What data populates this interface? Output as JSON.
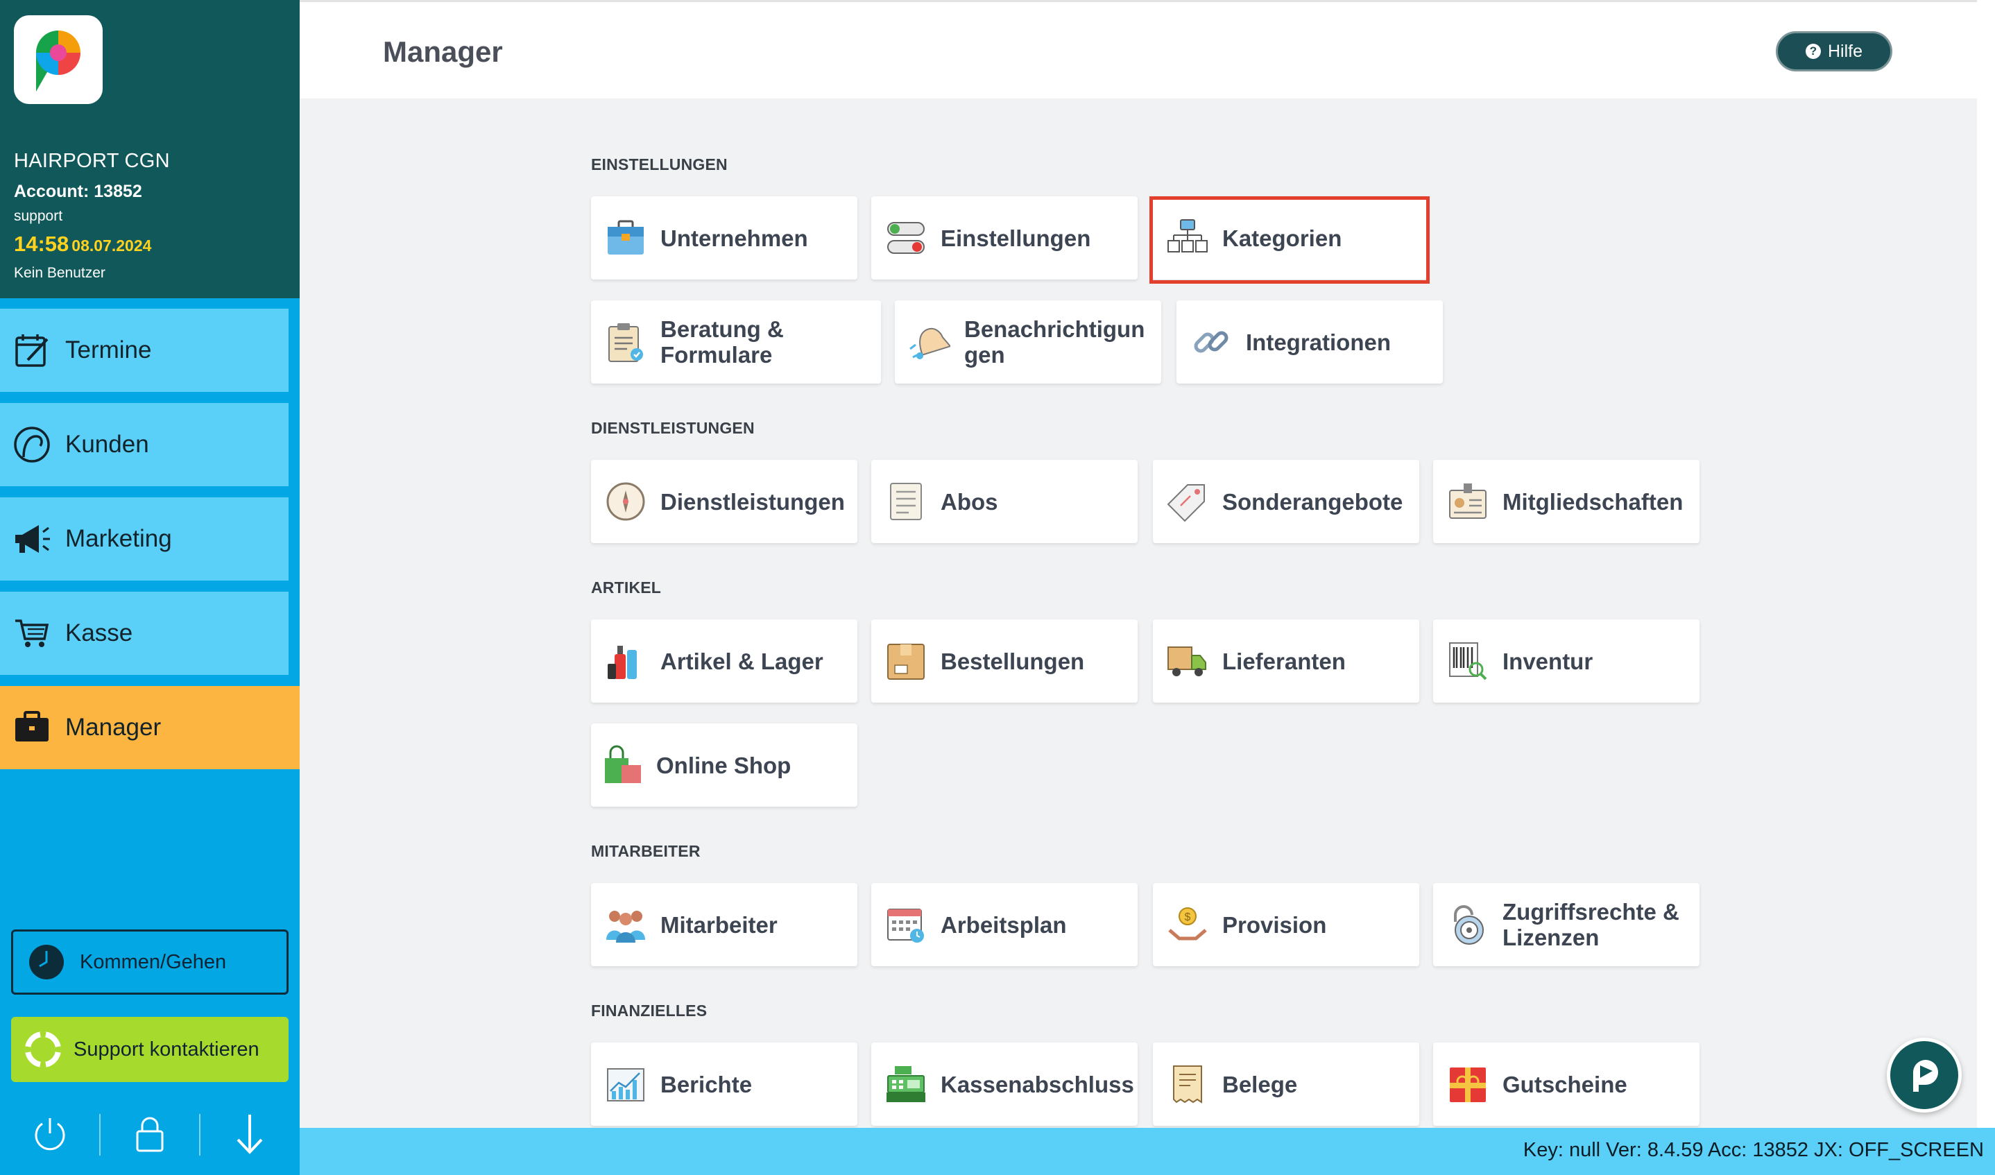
{
  "sidebar": {
    "company": "HAIRPORT CGN",
    "account": "Account: 13852",
    "user": "support",
    "time": "14:58",
    "date": "08.07.2024",
    "no_user": "Kein Benutzer",
    "nav": [
      {
        "label": "Termine",
        "icon": "calendar-icon"
      },
      {
        "label": "Kunden",
        "icon": "customer-icon"
      },
      {
        "label": "Marketing",
        "icon": "megaphone-icon"
      },
      {
        "label": "Kasse",
        "icon": "cart-icon"
      },
      {
        "label": "Manager",
        "icon": "briefcase-icon",
        "active": true
      }
    ],
    "kommen_gehen": "Kommen/Gehen",
    "support": "Support kontaktieren",
    "bottom_icons": [
      "power-icon",
      "lock-icon",
      "arrow-down-icon"
    ]
  },
  "header": {
    "title": "Manager",
    "help": "Hilfe"
  },
  "sections": [
    {
      "title": "EINSTELLUNGEN",
      "items": [
        {
          "label": "Unternehmen",
          "icon": "briefcase-icon"
        },
        {
          "label": "Einstellungen",
          "icon": "toggles-icon"
        },
        {
          "label": "Kategorien",
          "icon": "hierarchy-icon",
          "highlighted": true
        },
        {
          "label": "Beratung & Formulare",
          "icon": "clipboard-icon"
        },
        {
          "label": "Benachrichtigungen",
          "icon": "bell-icon"
        },
        {
          "label": "Integrationen",
          "icon": "link-icon"
        }
      ]
    },
    {
      "title": "DIENSTLEISTUNGEN",
      "items": [
        {
          "label": "Dienstleistungen",
          "icon": "compass-icon"
        },
        {
          "label": "Abos",
          "icon": "list-icon"
        },
        {
          "label": "Sonderangebote",
          "icon": "tag-icon"
        },
        {
          "label": "Mitgliedschaften",
          "icon": "id-card-icon"
        }
      ]
    },
    {
      "title": "ARTIKEL",
      "items": [
        {
          "label": "Artikel & Lager",
          "icon": "products-icon"
        },
        {
          "label": "Bestellungen",
          "icon": "box-icon"
        },
        {
          "label": "Lieferanten",
          "icon": "truck-icon"
        },
        {
          "label": "Inventur",
          "icon": "barcode-icon"
        },
        {
          "label": "Online Shop",
          "icon": "shopping-bag-icon"
        }
      ]
    },
    {
      "title": "MITARBEITER",
      "items": [
        {
          "label": "Mitarbeiter",
          "icon": "team-icon"
        },
        {
          "label": "Arbeitsplan",
          "icon": "schedule-icon"
        },
        {
          "label": "Provision",
          "icon": "coin-hand-icon"
        },
        {
          "label": "Zugriffsrechte & Lizenzen",
          "icon": "padlock-icon"
        }
      ]
    },
    {
      "title": "FINANZIELLES",
      "items": [
        {
          "label": "Berichte",
          "icon": "chart-icon"
        },
        {
          "label": "Kassenabschluss",
          "icon": "register-icon"
        },
        {
          "label": "Belege",
          "icon": "receipt-icon"
        },
        {
          "label": "Gutscheine",
          "icon": "gift-icon"
        }
      ]
    }
  ],
  "footer": {
    "status": "Key: null Ver: 8.4.59 Acc: 13852  JX: OFF_SCREEN"
  },
  "colors": {
    "sidebar_top": "#11585b",
    "sidebar": "#03a7e3",
    "nav_item": "#5acff7",
    "nav_active": "#fbb540",
    "support": "#a6da2d",
    "highlight": "#e2402d"
  }
}
